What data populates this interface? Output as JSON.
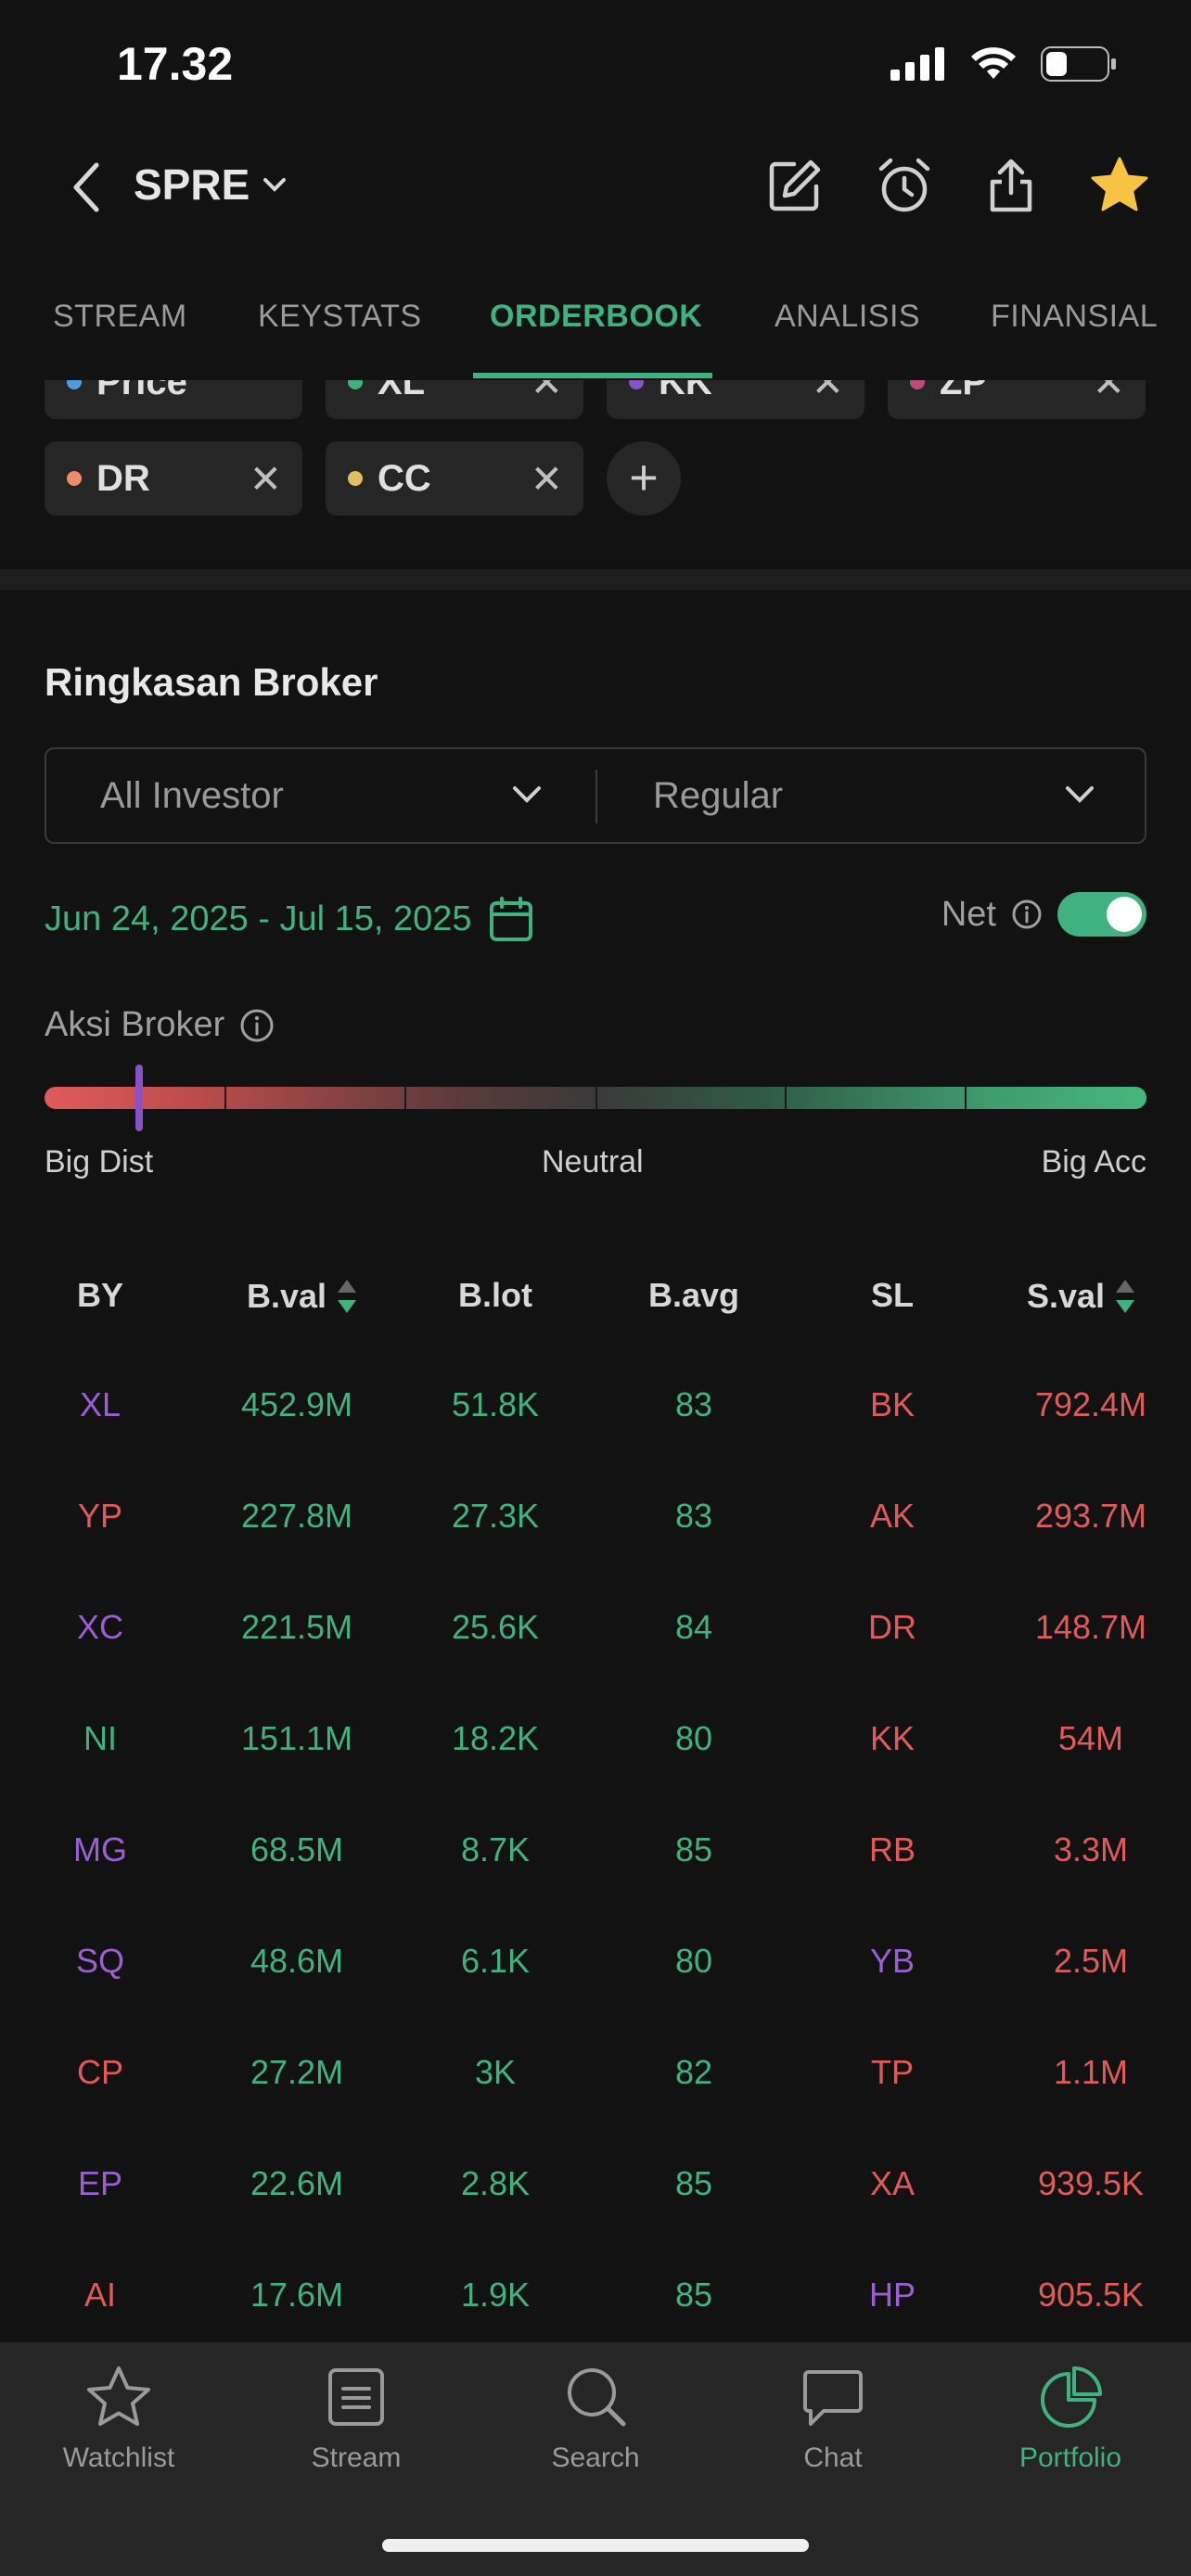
{
  "status_bar": {
    "time": "17.32"
  },
  "header": {
    "ticker": "SPRE"
  },
  "tabs": [
    "STREAM",
    "KEYSTATS",
    "ORDERBOOK",
    "ANALISIS",
    "FINANSIAL"
  ],
  "chips": [
    {
      "label": "Price",
      "color": "#4f9bde"
    },
    {
      "label": "XL",
      "color": "#3fb27f"
    },
    {
      "label": "KK",
      "color": "#8a52c8"
    },
    {
      "label": "ZP",
      "color": "#c04a7a"
    },
    {
      "label": "DR",
      "color": "#f08a6a"
    },
    {
      "label": "CC",
      "color": "#e0c060"
    }
  ],
  "section": {
    "title": "Ringkasan Broker",
    "investor_select": "All Investor",
    "market_select": "Regular",
    "date_range": "Jun 24, 2025 - Jul 15, 2025",
    "net_label": "Net",
    "net_enabled": true
  },
  "aksi": {
    "title": "Aksi Broker",
    "left_label": "Big Dist",
    "center_label": "Neutral",
    "right_label": "Big Acc"
  },
  "table": {
    "headers": [
      "BY",
      "B.val",
      "B.lot",
      "B.avg",
      "SL",
      "S.val"
    ],
    "rows": [
      [
        "XL",
        "452.9M",
        "51.8K",
        "83",
        "BK",
        "792.4M"
      ],
      [
        "YP",
        "227.8M",
        "27.3K",
        "83",
        "AK",
        "293.7M"
      ],
      [
        "XC",
        "221.5M",
        "25.6K",
        "84",
        "DR",
        "148.7M"
      ],
      [
        "NI",
        "151.1M",
        "18.2K",
        "80",
        "KK",
        "54M"
      ],
      [
        "MG",
        "68.5M",
        "8.7K",
        "85",
        "RB",
        "3.3M"
      ],
      [
        "SQ",
        "48.6M",
        "6.1K",
        "80",
        "YB",
        "2.5M"
      ],
      [
        "CP",
        "27.2M",
        "3K",
        "82",
        "TP",
        "1.1M"
      ],
      [
        "EP",
        "22.6M",
        "2.8K",
        "85",
        "XA",
        "939.5K"
      ],
      [
        "AI",
        "17.6M",
        "1.9K",
        "85",
        "HP",
        "905.5K"
      ]
    ],
    "by_colors": [
      "purple",
      "red",
      "purple",
      "green",
      "purple",
      "purple",
      "red",
      "purple",
      "red"
    ],
    "sl_colors": [
      "red",
      "red",
      "red",
      "red",
      "red",
      "purple",
      "red",
      "red",
      "purple"
    ]
  },
  "nav": [
    "Watchlist",
    "Stream",
    "Search",
    "Chat",
    "Portfolio"
  ],
  "colors": {
    "accent": "#3fb27f",
    "sell": "#e05a5a",
    "foreign": "#9b5fd4"
  }
}
